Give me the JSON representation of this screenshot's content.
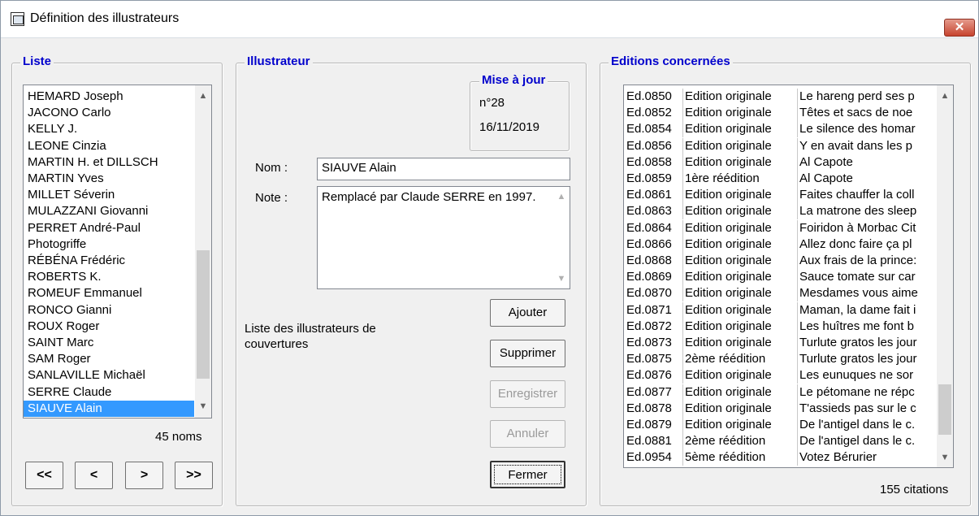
{
  "window": {
    "title": "Définition des illustrateurs",
    "close_label": "✕"
  },
  "liste": {
    "legend": "Liste",
    "items": [
      "HEMARD Joseph",
      "JACONO Carlo",
      "KELLY J.",
      "LEONE Cinzia",
      "MARTIN H. et DILLSCH",
      "MARTIN Yves",
      "MILLET Séverin",
      "MULAZZANI Giovanni",
      "PERRET André-Paul",
      "Photogriffe",
      "RÉBÉNA Frédéric",
      "ROBERTS K.",
      "ROMEUF Emmanuel",
      "RONCO Gianni",
      "ROUX Roger",
      "SAINT Marc",
      "SAM Roger",
      "SANLAVILLE Michaël",
      "SERRE Claude",
      "SIAUVE Alain"
    ],
    "selected": "SIAUVE Alain",
    "count": "45 noms",
    "nav": {
      "first": "<<",
      "prev": "<",
      "next": ">",
      "last": ">>"
    }
  },
  "illustrateur": {
    "legend": "Illustrateur",
    "mise_a_jour": {
      "legend": "Mise à jour",
      "number": "n°28",
      "date": "16/11/2019"
    },
    "nom_label": "Nom :",
    "nom_value": "SIAUVE Alain",
    "note_label": "Note :",
    "note_value": "Remplacé par Claude SERRE en 1997.",
    "description": "Liste des illustrateurs de couvertures",
    "buttons": {
      "ajouter": "Ajouter",
      "supprimer": "Supprimer",
      "enregistrer": "Enregistrer",
      "annuler": "Annuler",
      "fermer": "Fermer"
    }
  },
  "editions": {
    "legend": "Editions concernées",
    "rows": [
      {
        "ref": "Ed.0850",
        "type": "Edition originale",
        "title": "Le hareng perd ses p"
      },
      {
        "ref": "Ed.0852",
        "type": "Edition originale",
        "title": "Têtes et sacs de noe"
      },
      {
        "ref": "Ed.0854",
        "type": "Edition originale",
        "title": "Le silence des homar"
      },
      {
        "ref": "Ed.0856",
        "type": "Edition originale",
        "title": "Y en avait dans les p"
      },
      {
        "ref": "Ed.0858",
        "type": "Edition originale",
        "title": "Al Capote"
      },
      {
        "ref": "Ed.0859",
        "type": "1ère réédition",
        "title": "Al Capote"
      },
      {
        "ref": "Ed.0861",
        "type": "Edition originale",
        "title": "Faites chauffer la coll"
      },
      {
        "ref": "Ed.0863",
        "type": "Edition originale",
        "title": "La matrone des sleep"
      },
      {
        "ref": "Ed.0864",
        "type": "Edition originale",
        "title": "Foiridon à Morbac Cit"
      },
      {
        "ref": "Ed.0866",
        "type": "Edition originale",
        "title": "Allez donc faire ça pl"
      },
      {
        "ref": "Ed.0868",
        "type": "Edition originale",
        "title": "Aux frais de la prince:"
      },
      {
        "ref": "Ed.0869",
        "type": "Edition originale",
        "title": "Sauce tomate sur car"
      },
      {
        "ref": "Ed.0870",
        "type": "Edition originale",
        "title": "Mesdames vous aime"
      },
      {
        "ref": "Ed.0871",
        "type": "Edition originale",
        "title": "Maman, la dame fait i"
      },
      {
        "ref": "Ed.0872",
        "type": "Edition originale",
        "title": "Les huîtres me font b"
      },
      {
        "ref": "Ed.0873",
        "type": "Edition originale",
        "title": "Turlute gratos les jour"
      },
      {
        "ref": "Ed.0875",
        "type": "2ème réédition",
        "title": "Turlute gratos les jour"
      },
      {
        "ref": "Ed.0876",
        "type": "Edition originale",
        "title": "Les eunuques ne sor"
      },
      {
        "ref": "Ed.0877",
        "type": "Edition originale",
        "title": "Le pétomane ne répc"
      },
      {
        "ref": "Ed.0878",
        "type": "Edition originale",
        "title": "T'assieds pas sur le c"
      },
      {
        "ref": "Ed.0879",
        "type": "Edition originale",
        "title": "De l'antigel dans le c."
      },
      {
        "ref": "Ed.0881",
        "type": "2ème réédition",
        "title": "De l'antigel dans le c."
      },
      {
        "ref": "Ed.0954",
        "type": "5ème réédition",
        "title": "Votez Bérurier"
      }
    ],
    "count": "155 citations"
  }
}
